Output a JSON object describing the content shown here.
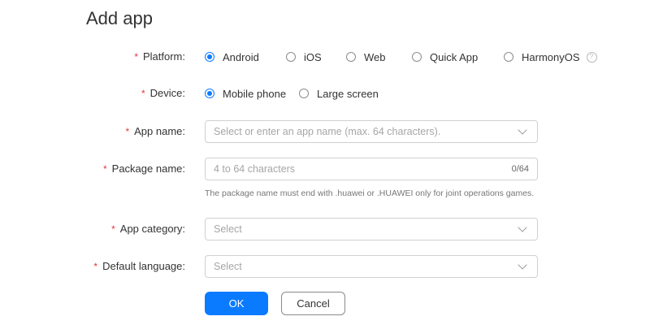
{
  "page": {
    "title": "Add app"
  },
  "form": {
    "required_mark": "*",
    "platform": {
      "label": "Platform:",
      "options": [
        "Android",
        "iOS",
        "Web",
        "Quick App",
        "HarmonyOS"
      ],
      "selected": "Android",
      "help_icon": "question-mark"
    },
    "device": {
      "label": "Device:",
      "options": [
        "Mobile phone",
        "Large screen"
      ],
      "selected": "Mobile phone"
    },
    "app_name": {
      "label": "App name:",
      "placeholder": "Select or enter an app name (max. 64 characters)."
    },
    "package_name": {
      "label": "Package name:",
      "placeholder": "4 to 64 characters",
      "counter": "0/64",
      "hint": "The package name must end with .huawei or .HUAWEI only for joint operations games."
    },
    "app_category": {
      "label": "App category:",
      "placeholder": "Select"
    },
    "default_language": {
      "label": "Default language:",
      "placeholder": "Select"
    }
  },
  "buttons": {
    "ok": "OK",
    "cancel": "Cancel"
  },
  "colors": {
    "accent": "#0a7bff",
    "required": "#e5383b"
  }
}
